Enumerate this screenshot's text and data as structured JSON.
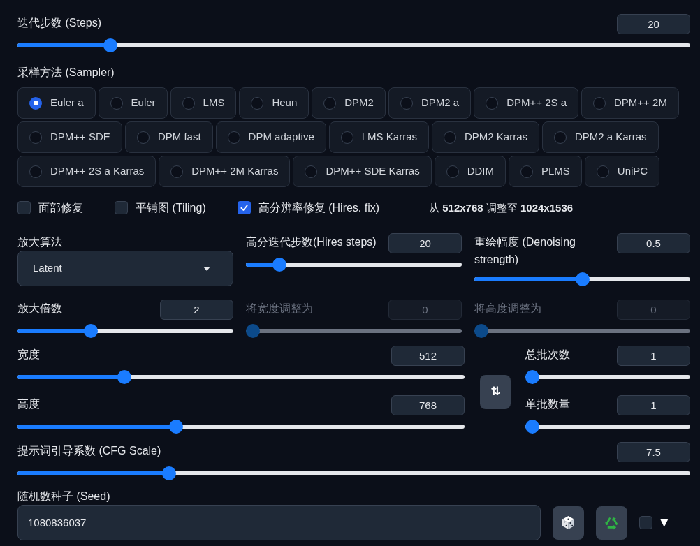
{
  "steps": {
    "label": "迭代步数 (Steps)",
    "value": "20",
    "level": 0.13
  },
  "sampler": {
    "label": "采样方法 (Sampler)",
    "options": [
      {
        "label": "Euler a",
        "selected": true
      },
      {
        "label": "Euler",
        "selected": false
      },
      {
        "label": "LMS",
        "selected": false
      },
      {
        "label": "Heun",
        "selected": false
      },
      {
        "label": "DPM2",
        "selected": false
      },
      {
        "label": "DPM2 a",
        "selected": false
      },
      {
        "label": "DPM++ 2S a",
        "selected": false
      },
      {
        "label": "DPM++ 2M",
        "selected": false
      },
      {
        "label": "DPM++ SDE",
        "selected": false
      },
      {
        "label": "DPM fast",
        "selected": false
      },
      {
        "label": "DPM adaptive",
        "selected": false
      },
      {
        "label": "LMS Karras",
        "selected": false
      },
      {
        "label": "DPM2 Karras",
        "selected": false
      },
      {
        "label": "DPM2 a Karras",
        "selected": false
      },
      {
        "label": "DPM++ 2S a Karras",
        "selected": false
      },
      {
        "label": "DPM++ 2M Karras",
        "selected": false
      },
      {
        "label": "DPM++ SDE Karras",
        "selected": false
      },
      {
        "label": "DDIM",
        "selected": false
      },
      {
        "label": "PLMS",
        "selected": false
      },
      {
        "label": "UniPC",
        "selected": false
      }
    ]
  },
  "toggles": [
    {
      "label": "面部修复",
      "checked": false
    },
    {
      "label": "平铺图 (Tiling)",
      "checked": false
    },
    {
      "label": "高分辨率修复 (Hires. fix)",
      "checked": true
    }
  ],
  "resize_info": "从 **512x768** 调整至 **1024x1536**",
  "hires": {
    "upscaler": {
      "label": "放大算法",
      "value": "Latent"
    },
    "sliders": [
      {
        "label": "高分迭代步数(Hires steps)",
        "value": "20",
        "level": 0.13,
        "disabled": false
      },
      {
        "label": "重绘幅度 (Denoising strength)",
        "value": "0.5",
        "level": 0.5,
        "disabled": false
      },
      {
        "label": "放大倍数",
        "value": "2",
        "level": 0.33,
        "disabled": false
      },
      {
        "label": "将宽度调整为",
        "value": "0",
        "level": 0,
        "disabled": true
      },
      {
        "label": "将高度调整为",
        "value": "0",
        "level": 0,
        "disabled": true
      }
    ]
  },
  "dimensions": {
    "sliders": [
      {
        "label": "宽度",
        "value": "512",
        "level": 0.23
      },
      {
        "label": "高度",
        "value": "768",
        "level": 0.35
      }
    ],
    "swap_button": "⇅"
  },
  "batch": {
    "sliders": [
      {
        "label": "总批次数",
        "value": "1",
        "level": 0
      },
      {
        "label": "单批数量",
        "value": "1",
        "level": 0
      }
    ]
  },
  "cfg_scale": {
    "label": "提示词引导系数 (CFG Scale)",
    "value": "7.5",
    "level": 0.22
  },
  "seed": {
    "label": "随机数种子 (Seed)",
    "value": "1080836037",
    "extra_checkbox": {
      "checked": false
    },
    "toggle": "▼"
  }
}
